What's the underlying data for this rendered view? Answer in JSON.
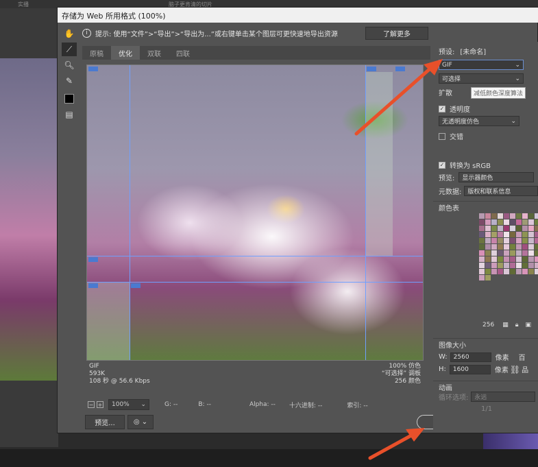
{
  "background": {
    "tabs": [
      "实播",
      "脑子更肯清的切片"
    ]
  },
  "dialog": {
    "title": "存储为 Web 所用格式 (100%)",
    "hint": "提示: 使用“文件”>“导出”>“导出为...”或右键单击某个图层可更快速地导出资源",
    "learn_more": "了解更多",
    "tabs": [
      {
        "label": "原稿"
      },
      {
        "label": "优化"
      },
      {
        "label": "双联"
      },
      {
        "label": "四联"
      }
    ],
    "status_left": [
      "GIF",
      "593K",
      "108 秒 @ 56.6 Kbps"
    ],
    "status_right": [
      "100% 仿色",
      "“可选择” 调板",
      "256 颜色"
    ],
    "zoom": "100%",
    "readouts": {
      "g": "G: --",
      "b": "B: --",
      "alpha": "Alpha: --",
      "hex": "十六进制: --",
      "index": "索引: --"
    },
    "preview_button": "预览...",
    "save_button": "存储...",
    "cancel_button": "取消"
  },
  "panel": {
    "preset_label": "预设:",
    "preset_value": "[未命名]",
    "format": "GIF",
    "reduction": "可选择",
    "dither_label": "扩散",
    "dither_tooltip": "减低颜色深度算法",
    "transparency_label": "透明度",
    "transparency_dither": "无透明度仿色",
    "interlaced_label": "交错",
    "convert_srgb": "转换为 sRGB",
    "preview_label": "预览:",
    "preview_value": "显示器颜色",
    "metadata_label": "元数据:",
    "metadata_value": "版权和联系信息",
    "color_table_label": "颜色表",
    "color_count": "256",
    "image_size_label": "图像大小",
    "width_label": "W:",
    "width_value": "2560",
    "height_label": "H:",
    "height_value": "1600",
    "unit": "像素",
    "percent_label": "百",
    "quality_label": "品",
    "animation_label": "动画",
    "loop_label": "循环选项:",
    "loop_value": "永远",
    "frame_label": "1/1"
  },
  "palette_colors": [
    "#b69ab0",
    "#c9869c",
    "#7e6a4c",
    "#e4d6d8",
    "#9a5a82",
    "#d2a8c0",
    "#6e7a44",
    "#e6b2cc",
    "#58663a",
    "#cfc4d6",
    "#a27c9a",
    "#7c4a68",
    "#d49abc",
    "#b8b0c8",
    "#8c8e52",
    "#ecd8e4",
    "#5e4e66",
    "#c46a9a",
    "#9e9a76",
    "#dcc6d8",
    "#6c7e3e",
    "#b48aa8",
    "#a66e8c",
    "#e0c0d2",
    "#7a8a4a",
    "#c2b6c8",
    "#9c3a70",
    "#d8d0de",
    "#5a6234",
    "#b490a8",
    "#e8a8c4",
    "#86704e",
    "#cabcce",
    "#6a5a78",
    "#dcb0c6",
    "#a4a066",
    "#b87ca0",
    "#f0e2ea",
    "#78683e",
    "#c89ab6",
    "#8e9454",
    "#d4c2d2",
    "#a2608a",
    "#e2bcd2",
    "#6c7440",
    "#bda8bc",
    "#c884aa",
    "#988c66",
    "#e4d0de",
    "#7c5070",
    "#d6a0c0",
    "#88904c",
    "#c8b8ca",
    "#b26894",
    "#eadce6",
    "#5c6a3a",
    "#ae8ca6",
    "#d0aac2",
    "#927a52",
    "#e6cadb",
    "#74803e",
    "#c298b4",
    "#a0507e",
    "#dccad8",
    "#647038",
    "#bc9cb4",
    "#d890b6",
    "#8a8252",
    "#ded0dc",
    "#6e5c72",
    "#caa2bc",
    "#9a9a5e",
    "#c2aec2",
    "#b4749c",
    "#eee0e8",
    "#66723a",
    "#b494ae",
    "#d6b2c8",
    "#8c7650",
    "#e0c8d6",
    "#7a883e",
    "#c690b2",
    "#a45c86",
    "#d8c4d4",
    "#5e6836",
    "#b898b0",
    "#dc98bc",
    "#86804c",
    "#e4d4e0",
    "#726078",
    "#cc9cba",
    "#9e9c62",
    "#c6b2c6",
    "#b06c96",
    "#ecdee6",
    "#626e38",
    "#b290aa",
    "#d2aec4",
    "#90784e",
    "#e2cad8",
    "#7e8a42",
    "#c894b4",
    "#a85a88",
    "#dac6d6",
    "#606a36",
    "#ba9ab2",
    "#d894b8",
    "#8a844e",
    "#e2d2de",
    "#705e76",
    "#cca0bc",
    "#a09e62"
  ],
  "colors": {
    "dialog_bg": "#535353",
    "accent": "#6a8fd0",
    "arrow": "#e8502a"
  }
}
